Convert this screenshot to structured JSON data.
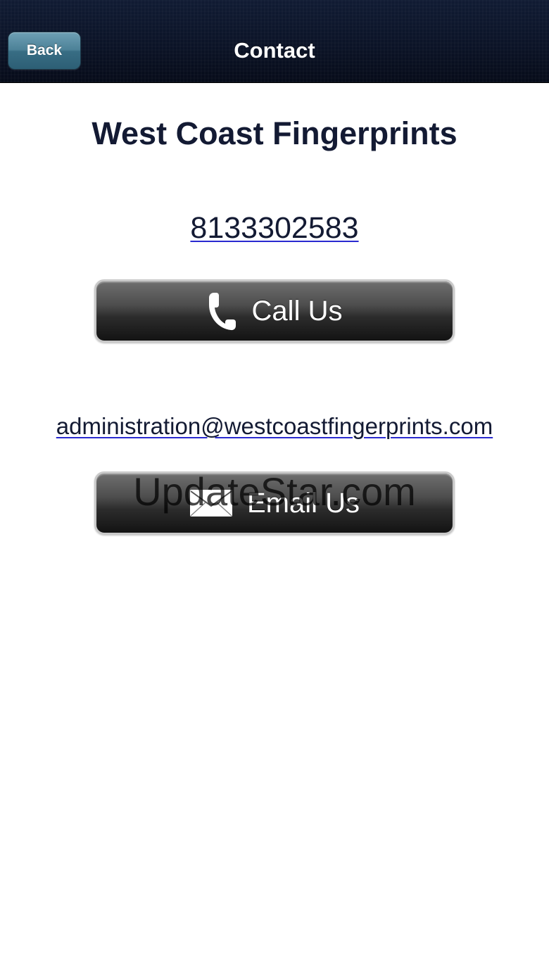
{
  "navbar": {
    "back_label": "Back",
    "title": "Contact"
  },
  "contact": {
    "business_name": "West Coast Fingerprints",
    "phone": "8133302583",
    "email": "administration@westcoastfingerprints.com"
  },
  "buttons": {
    "call_label": "Call Us",
    "call_icon": "phone-icon",
    "email_label": "Email Us",
    "email_icon": "envelope-icon"
  },
  "watermark": {
    "text": "UpdateStar.com"
  },
  "colors": {
    "navbar_bg": "#0b1327",
    "back_button": "#4c8197",
    "text_dark": "#131a33",
    "link_underline": "#2a2ad0",
    "button_dark": "#2c2c2c"
  }
}
